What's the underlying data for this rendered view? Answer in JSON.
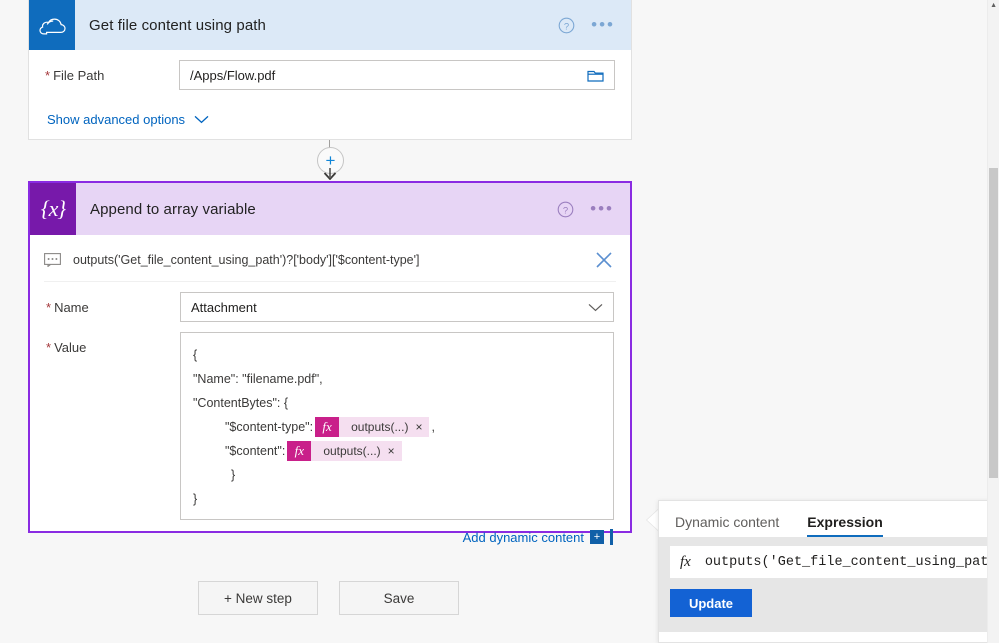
{
  "onedrive_card": {
    "icon": "onedrive-cloud-icon",
    "title": "Get file content using path",
    "help_icon": "help-circle-icon",
    "more_icon": "ellipsis-icon",
    "fields": [
      {
        "label": "File Path",
        "required": true,
        "value": "/Apps/Flow.pdf",
        "trailing_icon": "folder-picker-icon"
      }
    ],
    "show_advanced_label": "Show advanced options",
    "show_advanced_icon": "chevron-down-icon"
  },
  "connector": {
    "plus_label": "+",
    "plus_icon": "add-step-icon",
    "arrow_icon": "arrow-down-icon"
  },
  "variable_card": {
    "icon": "variable-braces-icon",
    "icon_glyph": "{x}",
    "title": "Append to array variable",
    "help_icon": "help-circle-icon",
    "more_icon": "ellipsis-icon",
    "expression_preview": {
      "icon": "comment-icon",
      "text": "outputs('Get_file_content_using_path')?['body']['$content-type']",
      "close_icon": "close-icon"
    },
    "name_field": {
      "label": "Name",
      "required": true,
      "value": "Attachment",
      "chevron_icon": "chevron-down-icon"
    },
    "value_field": {
      "label": "Value",
      "required": true,
      "lines": [
        {
          "indent": 0,
          "text": "{"
        },
        {
          "indent": 0,
          "text": "\"Name\": \"filename.pdf\","
        },
        {
          "indent": 0,
          "text": "\"ContentBytes\": {"
        },
        {
          "indent": 1,
          "text": "\"$content-type\":",
          "token": "outputs(...)",
          "suffix": ","
        },
        {
          "indent": 1,
          "text": "\"$content\":",
          "token": "outputs(...)",
          "suffix": ""
        },
        {
          "indent": 2,
          "text": "}"
        },
        {
          "indent": 0,
          "text": "}"
        }
      ],
      "token_fx": "fx",
      "token_remove": "×"
    },
    "add_dynamic_content": {
      "label": "Add dynamic content",
      "plus": "+",
      "icon": "add-dynamic-content-icon"
    }
  },
  "bottom_buttons": {
    "new_step": "+ New step",
    "save": "Save"
  },
  "flyout": {
    "tabs": [
      {
        "label": "Dynamic content",
        "active": false
      },
      {
        "label": "Expression",
        "active": true
      }
    ],
    "expression_input": {
      "fx": "fx",
      "value": "outputs('Get_file_content_using_path"
    },
    "update_button": "Update"
  },
  "colors": {
    "onedrive_icon_bg": "#0f6cbd",
    "onedrive_header_bg": "#dce9f7",
    "variable_icon_bg": "#7719aa",
    "variable_header_bg": "#e7d5f5",
    "card_selected_border": "#8a2be2",
    "token_chip_bg": "#f5dff0",
    "token_fx_bg": "#c9208a",
    "link_blue": "#0064bf",
    "primary_button": "#1362d4",
    "required_star": "#a4373a",
    "page_bg": "#f7f7f7"
  }
}
